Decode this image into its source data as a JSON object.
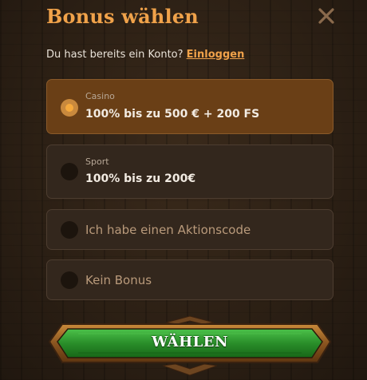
{
  "header": {
    "title": "Bonus wählen",
    "close_icon": "close-icon"
  },
  "account_prompt": {
    "text": "Du hast bereits ein Konto?",
    "link_label": "Einloggen"
  },
  "options": [
    {
      "category": "Casino",
      "label": "100% bis zu 500 € + 200 FS",
      "selected": true
    },
    {
      "category": "Sport",
      "label": "100% bis zu 200€",
      "selected": false
    },
    {
      "category": "",
      "label": "Ich habe einen Aktionscode",
      "selected": false
    },
    {
      "category": "",
      "label": "Kein Bonus",
      "selected": false
    }
  ],
  "cta": {
    "label": "WÄHLEN"
  },
  "colors": {
    "accent": "#f0a24a",
    "selected_bg": "#6a3f16",
    "option_bg": "#33271d",
    "cta_green": "#2f9a2f"
  }
}
